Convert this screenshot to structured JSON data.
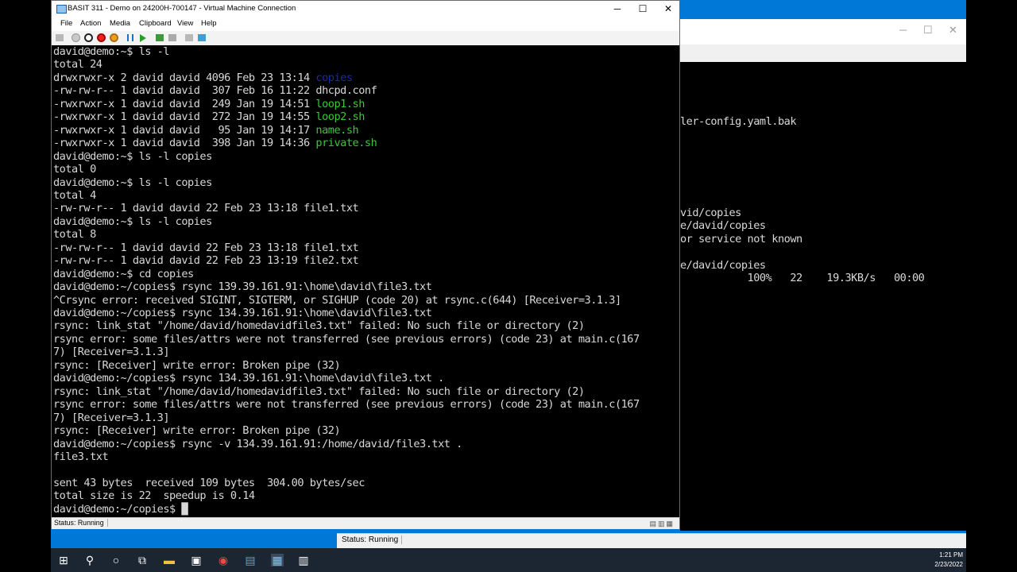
{
  "vm_window": {
    "title": "BASIT 311 - Demo on 24200H-700147 - Virtual Machine Connection",
    "controls": {
      "minimize": "─",
      "maximize": "☐",
      "close": "✕"
    },
    "menu": [
      "File",
      "Action",
      "Media",
      "Clipboard",
      "View",
      "Help"
    ],
    "status": "Status: Running"
  },
  "terminal_lines": [
    {
      "segs": [
        {
          "t": "david@demo:~$ ls -l"
        }
      ]
    },
    {
      "segs": [
        {
          "t": "total 24"
        }
      ]
    },
    {
      "segs": [
        {
          "t": "drwxrwxr-x 2 david david 4096 Feb 23 13:14 "
        },
        {
          "t": "copies",
          "c": "dir"
        }
      ]
    },
    {
      "segs": [
        {
          "t": "-rw-rw-r-- 1 david david  307 Feb 16 11:22 dhcpd.conf"
        }
      ]
    },
    {
      "segs": [
        {
          "t": "-rwxrwxr-x 1 david david  249 Jan 19 14:51 "
        },
        {
          "t": "loop1.sh",
          "c": "exe"
        }
      ]
    },
    {
      "segs": [
        {
          "t": "-rwxrwxr-x 1 david david  272 Jan 19 14:55 "
        },
        {
          "t": "loop2.sh",
          "c": "exe"
        }
      ]
    },
    {
      "segs": [
        {
          "t": "-rwxrwxr-x 1 david david   95 Jan 19 14:17 "
        },
        {
          "t": "name.sh",
          "c": "exe"
        }
      ]
    },
    {
      "segs": [
        {
          "t": "-rwxrwxr-x 1 david david  398 Jan 19 14:36 "
        },
        {
          "t": "private.sh",
          "c": "exe"
        }
      ]
    },
    {
      "segs": [
        {
          "t": "david@demo:~$ ls -l copies"
        }
      ]
    },
    {
      "segs": [
        {
          "t": "total 0"
        }
      ]
    },
    {
      "segs": [
        {
          "t": "david@demo:~$ ls -l copies"
        }
      ]
    },
    {
      "segs": [
        {
          "t": "total 4"
        }
      ]
    },
    {
      "segs": [
        {
          "t": "-rw-rw-r-- 1 david david 22 Feb 23 13:18 file1.txt"
        }
      ]
    },
    {
      "segs": [
        {
          "t": "david@demo:~$ ls -l copies"
        }
      ]
    },
    {
      "segs": [
        {
          "t": "total 8"
        }
      ]
    },
    {
      "segs": [
        {
          "t": "-rw-rw-r-- 1 david david 22 Feb 23 13:18 file1.txt"
        }
      ]
    },
    {
      "segs": [
        {
          "t": "-rw-rw-r-- 1 david david 22 Feb 23 13:19 file2.txt"
        }
      ]
    },
    {
      "segs": [
        {
          "t": "david@demo:~$ cd copies"
        }
      ]
    },
    {
      "segs": [
        {
          "t": "david@demo:~/copies$ rsync 139.39.161.91:\\home\\david\\file3.txt"
        }
      ]
    },
    {
      "segs": [
        {
          "t": "^Crsync error: received SIGINT, SIGTERM, or SIGHUP (code 20) at rsync.c(644) [Receiver=3.1.3]"
        }
      ]
    },
    {
      "segs": [
        {
          "t": "david@demo:~/copies$ rsync 134.39.161.91:\\home\\david\\file3.txt"
        }
      ]
    },
    {
      "segs": [
        {
          "t": "rsync: link_stat \"/home/david/homedavidfile3.txt\" failed: No such file or directory (2)"
        }
      ]
    },
    {
      "segs": [
        {
          "t": "rsync error: some files/attrs were not transferred (see previous errors) (code 23) at main.c(167"
        }
      ]
    },
    {
      "segs": [
        {
          "t": "7) [Receiver=3.1.3]"
        }
      ]
    },
    {
      "segs": [
        {
          "t": "rsync: [Receiver] write error: Broken pipe (32)"
        }
      ]
    },
    {
      "segs": [
        {
          "t": "david@demo:~/copies$ rsync 134.39.161.91:\\home\\david\\file3.txt ."
        }
      ]
    },
    {
      "segs": [
        {
          "t": "rsync: link_stat \"/home/david/homedavidfile3.txt\" failed: No such file or directory (2)"
        }
      ]
    },
    {
      "segs": [
        {
          "t": "rsync error: some files/attrs were not transferred (see previous errors) (code 23) at main.c(167"
        }
      ]
    },
    {
      "segs": [
        {
          "t": "7) [Receiver=3.1.3]"
        }
      ]
    },
    {
      "segs": [
        {
          "t": "rsync: [Receiver] write error: Broken pipe (32)"
        }
      ]
    },
    {
      "segs": [
        {
          "t": "david@demo:~/copies$ rsync -v 134.39.161.91:/home/david/file3.txt ."
        }
      ]
    },
    {
      "segs": [
        {
          "t": "file3.txt"
        }
      ]
    },
    {
      "segs": [
        {
          "t": ""
        }
      ]
    },
    {
      "segs": [
        {
          "t": "sent 43 bytes  received 109 bytes  304.00 bytes/sec"
        }
      ]
    },
    {
      "segs": [
        {
          "t": "total size is 22  speedup is 0.14"
        }
      ]
    },
    {
      "segs": [
        {
          "t": "david@demo:~/copies$ "
        },
        {
          "t": "█",
          "c": "cursor"
        }
      ]
    }
  ],
  "background_window": {
    "lines": [
      {
        "row": 6,
        "t": "ler-config.yaml.bak"
      },
      {
        "row": 13,
        "t": "vid/copies"
      },
      {
        "row": 14,
        "t": "e/david/copies"
      },
      {
        "row": 15,
        "t": "or service not known"
      },
      {
        "row": 17,
        "t": "e/david/copies"
      },
      {
        "row": 18,
        "t": "           100%   22    19.3KB/s   00:00"
      }
    ],
    "controls": {
      "minimize": "─",
      "maximize": "☐",
      "close": "✕"
    },
    "status": "Status: Running"
  },
  "taskbar": {
    "time": "1:21 PM",
    "date": "2/23/2022"
  },
  "colors": {
    "dir": "#1a2aa8",
    "exe": "#38c838",
    "terminal_text": "#d8d8d8",
    "desktop": "#0078d7"
  }
}
